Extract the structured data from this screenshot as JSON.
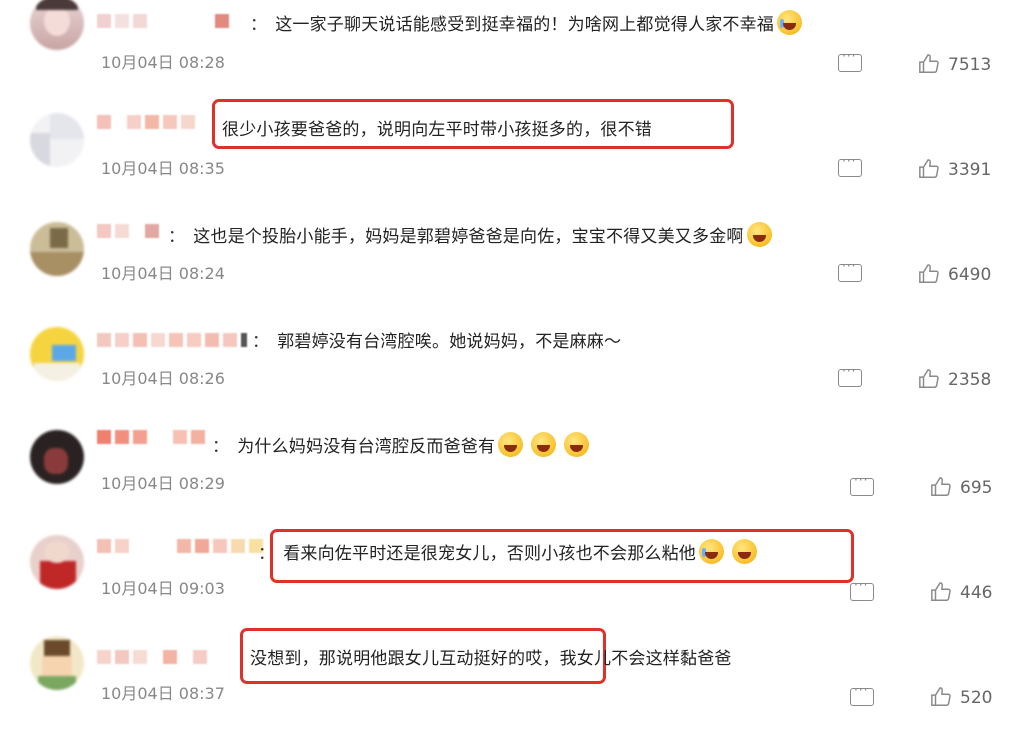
{
  "colors": {
    "highlight": "#e0302a",
    "meta_text": "#888888"
  },
  "icons": {
    "reply": "comment-icon",
    "like": "thumbs-up-icon",
    "emoji_cry": "crying-laugh-emoji",
    "emoji_laugh": "laughing-emoji",
    "emoji_pray": "praying-emoji"
  },
  "comments": [
    {
      "text": "这一家子聊天说话能感受到挺幸福的！为啥网上都觉得人家不幸福",
      "emoji": [
        "cry"
      ],
      "time": "10月04日 08:28",
      "likes": "7513"
    },
    {
      "text": "很少小孩要爸爸的，说明向左平时带小孩挺多的，很不错",
      "emoji": [],
      "time": "10月04日 08:35",
      "likes": "3391"
    },
    {
      "text": "这也是个投胎小能手，妈妈是郭碧婷爸爸是向佐，宝宝不得又美又多金啊",
      "emoji": [
        "pray"
      ],
      "time": "10月04日 08:24",
      "likes": "6490"
    },
    {
      "text": "郭碧婷没有台湾腔唉。她说妈妈，不是麻麻～",
      "emoji": [],
      "time": "10月04日 08:26",
      "likes": "2358"
    },
    {
      "text": "为什么妈妈没有台湾腔反而爸爸有",
      "emoji": [
        "laugh",
        "laugh",
        "laugh"
      ],
      "time": "10月04日 08:29",
      "likes": "695"
    },
    {
      "text": "看来向佐平时还是很宠女儿，否则小孩也不会那么粘他",
      "emoji": [
        "cry",
        "laugh"
      ],
      "time": "10月04日 09:03",
      "likes": "446"
    },
    {
      "text": "没想到，那说明他跟女儿互动挺好的哎，我女儿不会这样黏爸爸",
      "emoji": [],
      "time": "10月04日 08:37",
      "likes": "520"
    }
  ]
}
